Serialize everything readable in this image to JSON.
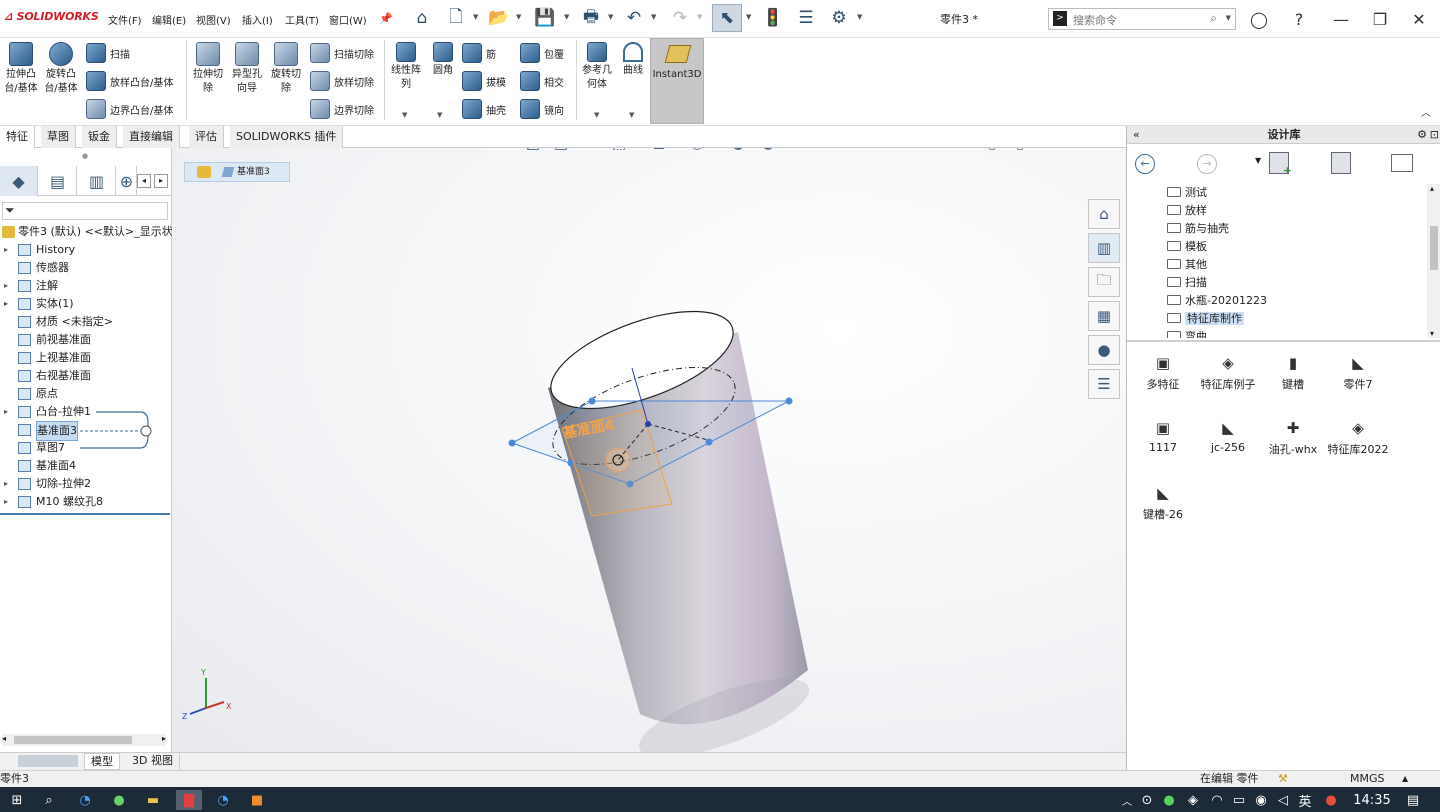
{
  "app": {
    "brand": "SOLIDWORKS",
    "doc_title": "零件3 *"
  },
  "menus": [
    "文件(F)",
    "编辑(E)",
    "视图(V)",
    "插入(I)",
    "工具(T)",
    "窗口(W)"
  ],
  "search": {
    "placeholder": "搜索命令"
  },
  "ribbon": {
    "extrude_boss": "拉伸凸台/基体",
    "revolve_boss": "旋转凸台/基体",
    "sweep": "扫描",
    "loft": "放样凸台/基体",
    "boundary_boss": "边界凸台/基体",
    "extrude_cut": "拉伸切除",
    "hole_wizard": "异型孔向导",
    "revolve_cut": "旋转切除",
    "swept_cut": "扫描切除",
    "lofted_cut": "放样切除",
    "boundary_cut": "边界切除",
    "linear_pattern": "线性阵列",
    "fillet": "圆角",
    "rib": "筋",
    "draft": "拔模",
    "shell": "抽壳",
    "wrap": "包覆",
    "intersect": "相交",
    "mirror": "镜向",
    "ref_geometry": "参考几何体",
    "curves": "曲线",
    "instant3d": "Instant3D"
  },
  "command_tabs": [
    "特征",
    "草图",
    "钣金",
    "直接编辑",
    "评估",
    "SOLIDWORKS 插件"
  ],
  "tree": {
    "root": "零件3 (默认) <<默认>_显示状",
    "items": [
      {
        "label": "History",
        "expandable": true
      },
      {
        "label": "传感器",
        "expandable": false
      },
      {
        "label": "注解",
        "expandable": true
      },
      {
        "label": "实体(1)",
        "expandable": true
      },
      {
        "label": "材质 <未指定>",
        "expandable": false
      },
      {
        "label": "前视基准面",
        "expandable": false
      },
      {
        "label": "上视基准面",
        "expandable": false
      },
      {
        "label": "右视基准面",
        "expandable": false
      },
      {
        "label": "原点",
        "expandable": false
      },
      {
        "label": "凸台-拉伸1",
        "expandable": true
      },
      {
        "label": "基准面3",
        "expandable": false,
        "selected": true
      },
      {
        "label": "草图7",
        "expandable": false
      },
      {
        "label": "基准面4",
        "expandable": false
      },
      {
        "label": "切除-拉伸2",
        "expandable": true
      },
      {
        "label": "M10 螺纹孔8",
        "expandable": true
      }
    ]
  },
  "viewport": {
    "breadcrumb": "基准面3",
    "plane_label": "基准面4",
    "triad": {
      "x": "X",
      "y": "Y",
      "z": "Z"
    }
  },
  "design_library": {
    "title": "设计库",
    "folders": [
      "测试",
      "放样",
      "筋与抽壳",
      "模板",
      "其他",
      "扫描",
      "水瓶-20201223",
      "特征库制作",
      "弯曲"
    ],
    "selected_folder": "特征库制作",
    "items": [
      "多特征",
      "特征库例子",
      "键槽",
      "零件7",
      "1117",
      "jc-256",
      "油孔-whx",
      "特征库2022",
      "键槽-26"
    ]
  },
  "bottom_tabs": [
    "模型",
    "3D 视图"
  ],
  "status": {
    "left": "零件3",
    "editing": "在编辑 零件",
    "units": "MMGS"
  },
  "taskbar": {
    "time": "14:35",
    "ime": "英"
  }
}
